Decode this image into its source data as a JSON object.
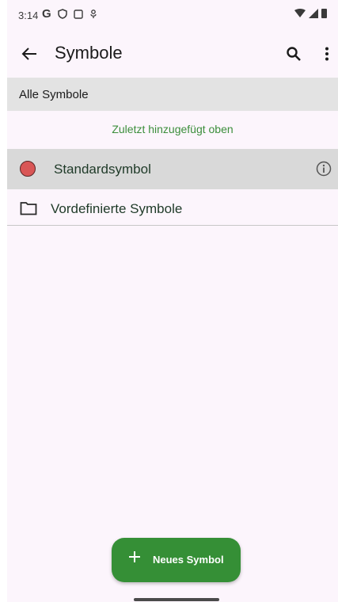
{
  "status_bar": {
    "time": "3:14",
    "left_icons": [
      "google-icon",
      "shield-icon",
      "screen-icon",
      "mic-icon"
    ],
    "right_icons": [
      "wifi-icon",
      "signal-icon",
      "battery-icon"
    ]
  },
  "app_bar": {
    "title": "Symbole",
    "back_icon": "arrow-left-icon",
    "search_icon": "search-icon",
    "more_icon": "more-vert-icon"
  },
  "filter": {
    "label": "Alle Symbole"
  },
  "sort_hint": "Zuletzt hinzugefügt oben",
  "list": {
    "items": [
      {
        "label": "Standardsymbol",
        "icon": "red-dot-icon",
        "action_icon": "info-icon",
        "selected": true,
        "dot_color": "#d95656"
      },
      {
        "label": "Vordefinierte Symbole",
        "icon": "folder-icon"
      }
    ]
  },
  "fab": {
    "label": "Neues Symbol",
    "icon": "plus-icon"
  },
  "colors": {
    "accent": "#358f36",
    "hint_text": "#3b8e3b",
    "background": "#fcf5fc"
  }
}
